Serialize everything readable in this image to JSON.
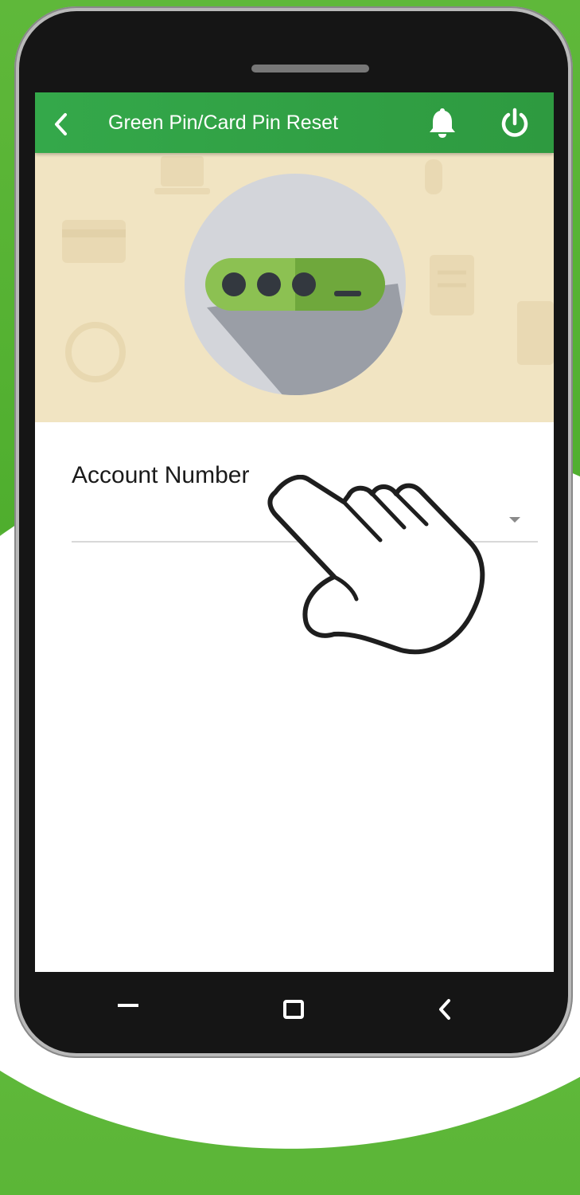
{
  "app": {
    "title": "Green Pin/Card Pin Reset"
  },
  "toolbar": {
    "back_icon": "chevron-left-icon",
    "notifications_icon": "bell-icon",
    "logout_icon": "power-icon"
  },
  "banner": {
    "illustration": "password-pin-icon"
  },
  "form": {
    "account_number_label": "Account Number",
    "account_number_value": ""
  },
  "system_nav": {
    "recents_icon": "minus-icon",
    "home_icon": "square-icon",
    "back_icon": "chevron-left-icon"
  },
  "colors": {
    "appbar": "#2e9a40",
    "banner": "#f1e4c2",
    "accent_green": "#7cc142"
  }
}
